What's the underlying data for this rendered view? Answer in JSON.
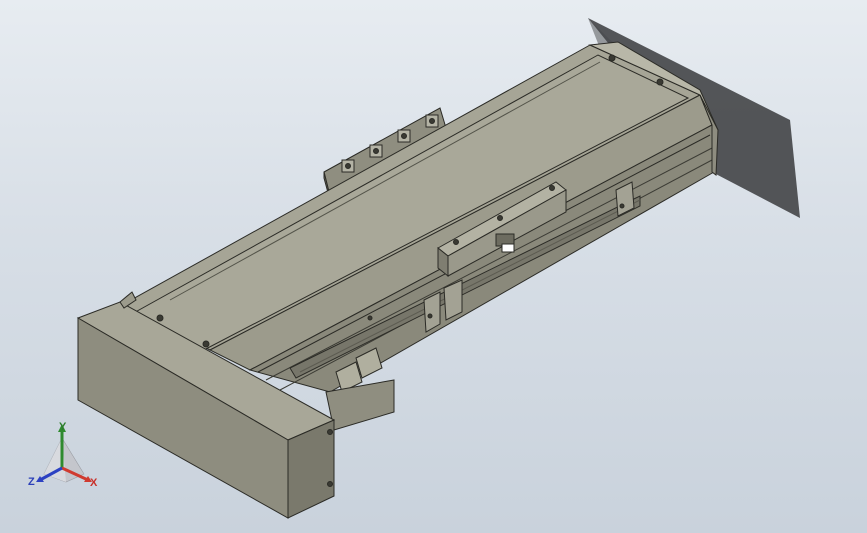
{
  "viewport": {
    "background_top": "#e7ecf1",
    "background_bottom": "#c9d2dc",
    "model": {
      "name": "linear-module-assembly",
      "body_color": "#a6a596",
      "edge_color": "#2b2b26",
      "shadow_color": "#3a3b3d"
    }
  },
  "triad": {
    "x_label": "X",
    "y_label": "Y",
    "z_label": "Z",
    "x_color": "#d03a2f",
    "y_color": "#2f8a2f",
    "z_color": "#2c41c2"
  }
}
